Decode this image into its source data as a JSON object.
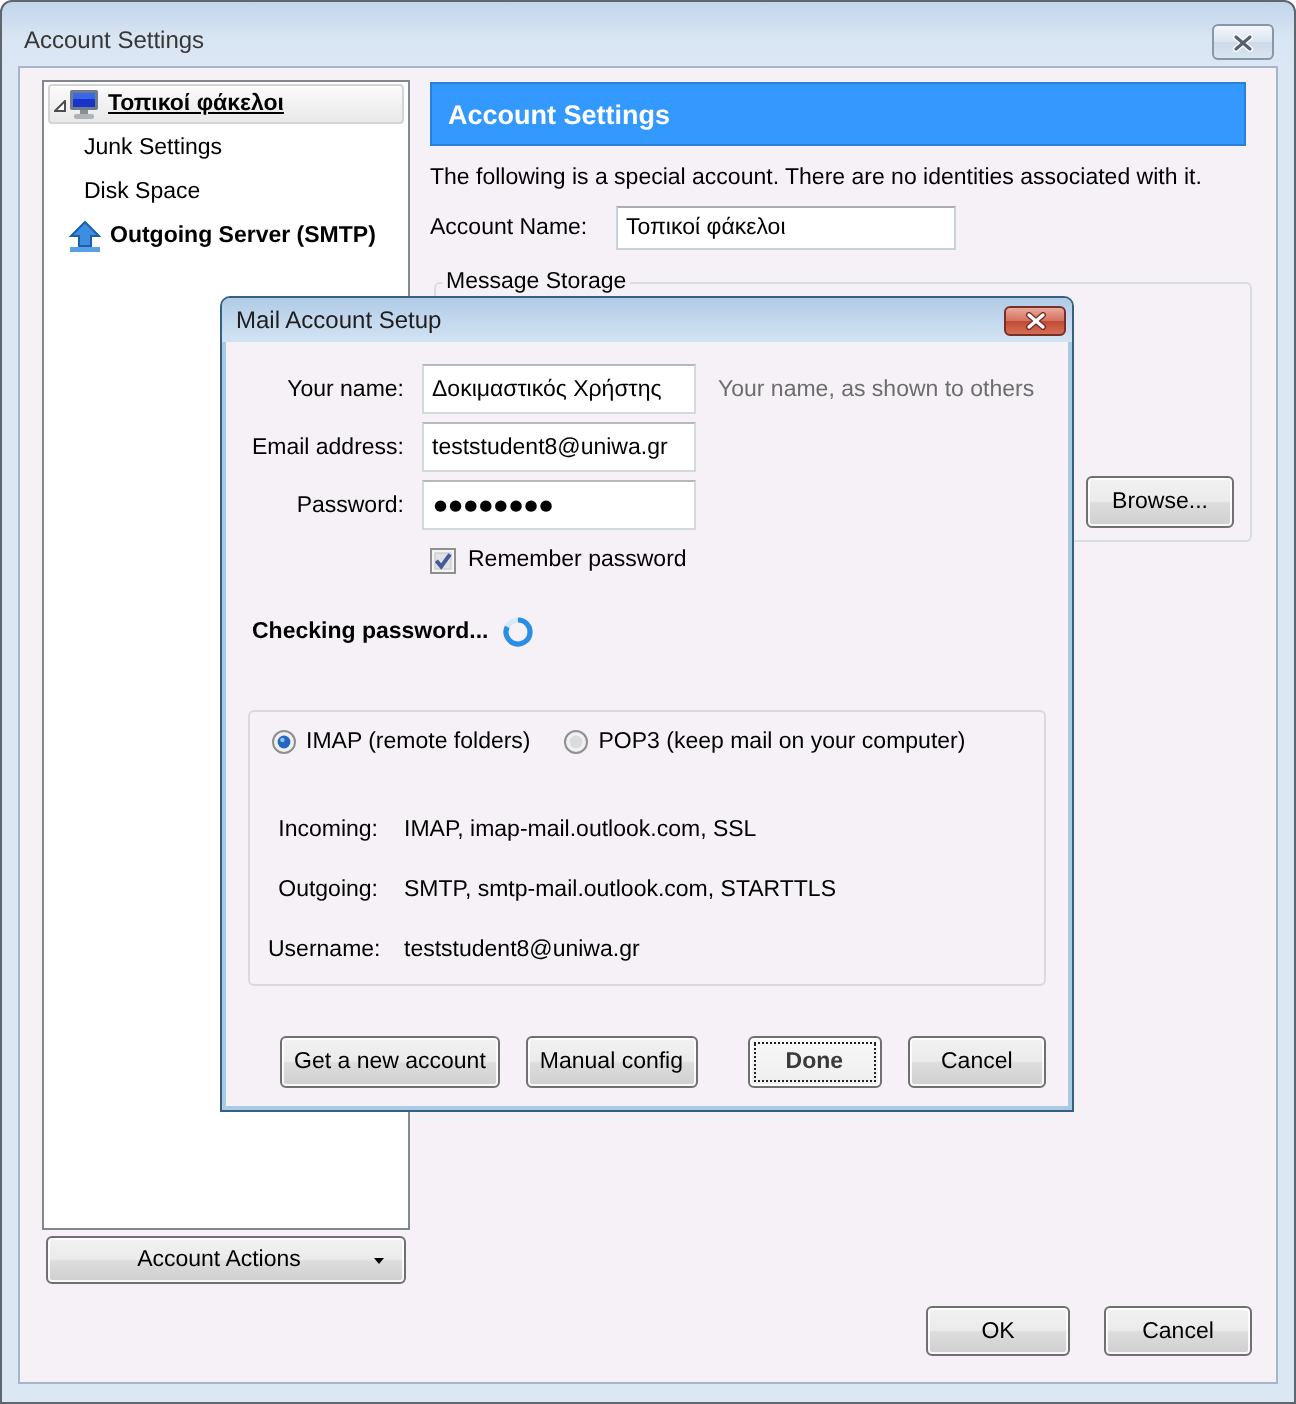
{
  "window": {
    "title": "Account Settings"
  },
  "sidebar": {
    "items": [
      {
        "kind": "account",
        "label": "Τοπικοί φάκελοι",
        "selected": true,
        "expanded": true,
        "children": [
          {
            "kind": "setting",
            "label": "Junk Settings",
            "selected": false
          },
          {
            "kind": "setting",
            "label": "Disk Space",
            "selected": false
          }
        ]
      },
      {
        "kind": "server",
        "label": "Outgoing Server (SMTP)",
        "selected": false
      }
    ],
    "actions_button": "Account Actions"
  },
  "panel": {
    "header": "Account Settings",
    "description": "The following is a special account. There are no identities associated with it.",
    "account_name": {
      "label": "Account Name:",
      "value": "Τοπικοί φάκελοι"
    },
    "message_storage": {
      "legend": "Message Storage",
      "browse_button": "Browse..."
    }
  },
  "buttons": [
    "OK",
    "Cancel"
  ],
  "dialog": {
    "title": "Mail Account Setup",
    "fields": [
      {
        "kind": "text",
        "label": "Your name:",
        "value": "Δοκιμαστικός Χρήστης",
        "hint": "Your name, as shown to others"
      },
      {
        "kind": "text",
        "label": "Email address:",
        "value": "teststudent8@uniwa.gr"
      },
      {
        "kind": "password",
        "label": "Password:",
        "value": "●●●●●●●●"
      }
    ],
    "remember_password": {
      "label": "Remember password",
      "checked": true
    },
    "status": {
      "text": "Checking password...",
      "busy": true
    },
    "protocols": [
      {
        "label": "IMAP (remote folders)",
        "selected": true
      },
      {
        "label": "POP3 (keep mail on your computer)",
        "selected": false
      }
    ],
    "server_settings": [
      {
        "label": "Incoming:",
        "value": "IMAP, imap-mail.outlook.com, SSL"
      },
      {
        "label": "Outgoing:",
        "value": "SMTP, smtp-mail.outlook.com, STARTTLS"
      },
      {
        "label": "Username:",
        "value": "teststudent8@uniwa.gr"
      }
    ],
    "buttons": [
      {
        "label": "Get a new account",
        "default": false
      },
      {
        "label": "Manual config",
        "default": false
      },
      {
        "label": "Done",
        "default": true
      },
      {
        "label": "Cancel",
        "default": false
      }
    ]
  }
}
